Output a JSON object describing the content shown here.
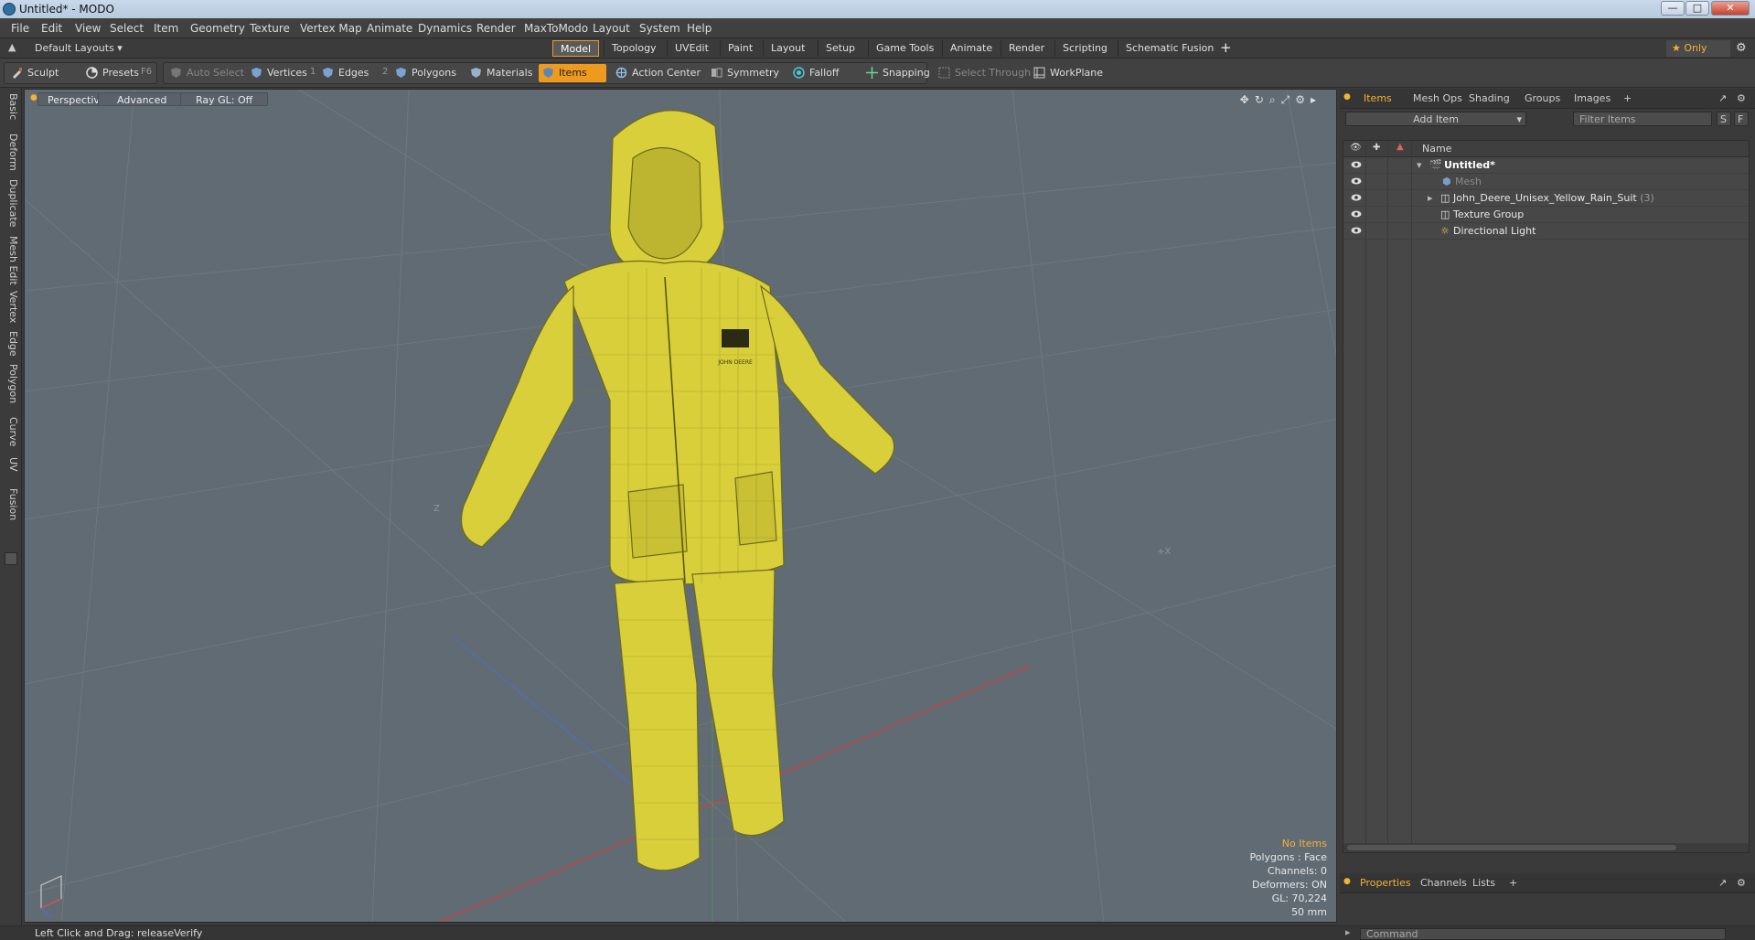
{
  "window": {
    "title": "Untitled* - MODO",
    "minimize": "—",
    "maximize": "□",
    "close": "✕"
  },
  "menu": [
    "File",
    "Edit",
    "View",
    "Select",
    "Item",
    "Geometry",
    "Texture",
    "Vertex Map",
    "Animate",
    "Dynamics",
    "Render",
    "MaxToModo",
    "Layout",
    "System",
    "Help"
  ],
  "layouts": {
    "dropdown": "Default Layouts ▾",
    "tabs": [
      "Model",
      "Topology",
      "UVEdit",
      "Paint",
      "Layout",
      "Setup",
      "Game Tools",
      "Animate",
      "Render",
      "Scripting",
      "Schematic Fusion"
    ],
    "active_tab": "Model",
    "add": "+",
    "only": "★  Only"
  },
  "toolbar": {
    "sculpt": "Sculpt",
    "presets": "Presets",
    "presets_key": "F6",
    "auto_select": "Auto Select",
    "vertices": "Vertices",
    "vertices_key": "1",
    "edges": "Edges",
    "edges_key": "2",
    "polygons": "Polygons",
    "materials": "Materials",
    "items": "Items",
    "action_center": "Action Center",
    "symmetry": "Symmetry",
    "falloff": "Falloff",
    "snapping": "Snapping",
    "select_through": "Select Through",
    "workplane": "WorkPlane"
  },
  "left_tabs": [
    "Basic",
    "Deform",
    "Duplicate",
    "Mesh Edit",
    "Vertex",
    "Edge",
    "Polygon",
    "Curve",
    "UV",
    "Fusion"
  ],
  "viewport": {
    "view": "Perspective",
    "shading": "Advanced",
    "raygl": "Ray GL: Off",
    "icons": "✥↻⌕⤢⚙▸",
    "axis_x": "+X",
    "axis_z": "Z",
    "logo_text": "JOHN DEERE",
    "stats": {
      "selection": "No Items",
      "polygons": "Polygons : Face",
      "channels": "Channels: 0",
      "deformers": "Deformers: ON",
      "gl": "GL: 70,224",
      "focal": "50 mm"
    }
  },
  "items_panel": {
    "tabs": [
      "Items",
      "Mesh Ops",
      "Shading",
      "Groups",
      "Images"
    ],
    "add_tab": "+",
    "add_item": "Add Item",
    "filter_placeholder": "Filter Items",
    "s_btn": "S",
    "f_btn": "F",
    "column_name": "Name",
    "rows": [
      {
        "label": "Untitled*",
        "style": "bold"
      },
      {
        "label": "Mesh",
        "style": "dim"
      },
      {
        "label": "John_Deere_Unisex_Yellow_Rain_Suit",
        "count": "(3)",
        "style": "normal"
      },
      {
        "label": "Texture Group",
        "style": "normal"
      },
      {
        "label": "Directional Light",
        "style": "normal"
      }
    ]
  },
  "properties_panel": {
    "tabs": [
      "Properties",
      "Channels",
      "Lists"
    ],
    "add_tab": "+"
  },
  "status": {
    "text": "Left Click and Drag:  releaseVerify",
    "command_placeholder": "Command"
  },
  "colors": {
    "accent": "#ee9a1e",
    "viewport_bg": "#616b73",
    "suit": "#d8cf3a"
  }
}
